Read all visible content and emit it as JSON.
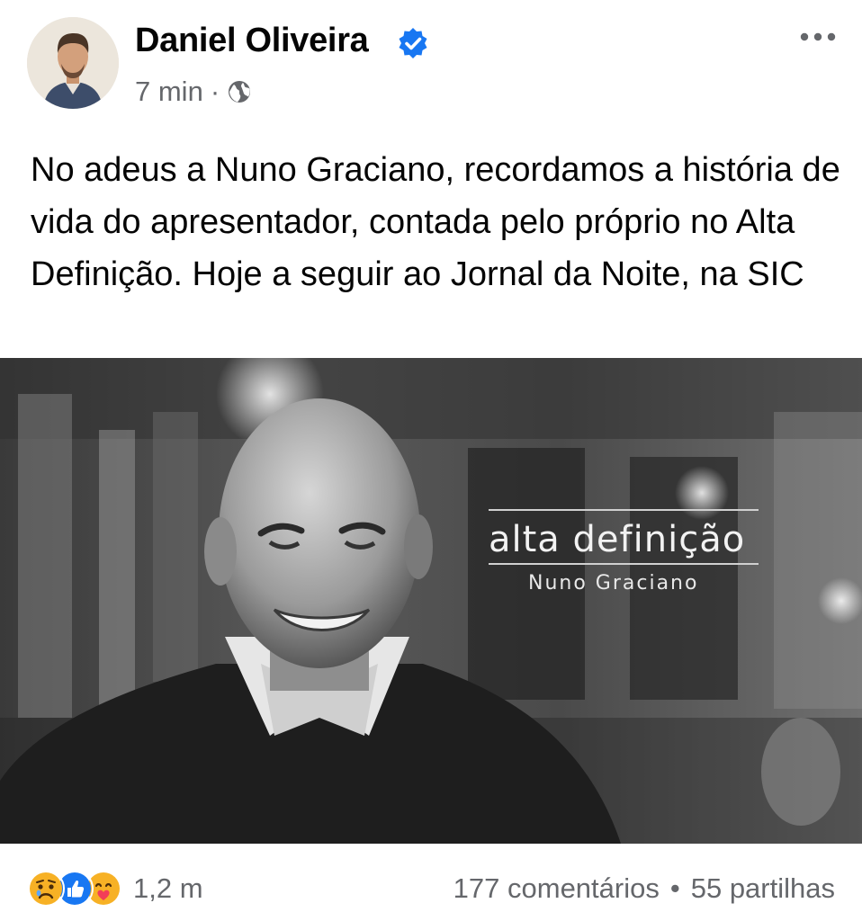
{
  "post": {
    "author": "Daniel Oliveira",
    "time": "7 min",
    "separator": "·",
    "text": "No adeus a Nuno Graciano, recordamos a história de vida do apresentador, contada pelo próprio no Alta Definição. Hoje a seguir ao Jornal da Noite, na SIC",
    "privacy_icon": "globe-icon",
    "more_icon": "more-horizontal-icon"
  },
  "image": {
    "overlay_title": "alta definição",
    "overlay_subtitle": "Nuno Graciano"
  },
  "footer": {
    "reactions": [
      "sad-reaction-icon",
      "like-reaction-icon",
      "care-reaction-icon"
    ],
    "reaction_count": "1,2 m",
    "comments": "177 comentários",
    "stats_separator": "•",
    "shares": "55 partilhas"
  },
  "colors": {
    "verified_blue": "#1877f2",
    "secondary_text": "#65676b",
    "like_blue": "#1877f2",
    "reaction_yellow": "#f7b125"
  }
}
